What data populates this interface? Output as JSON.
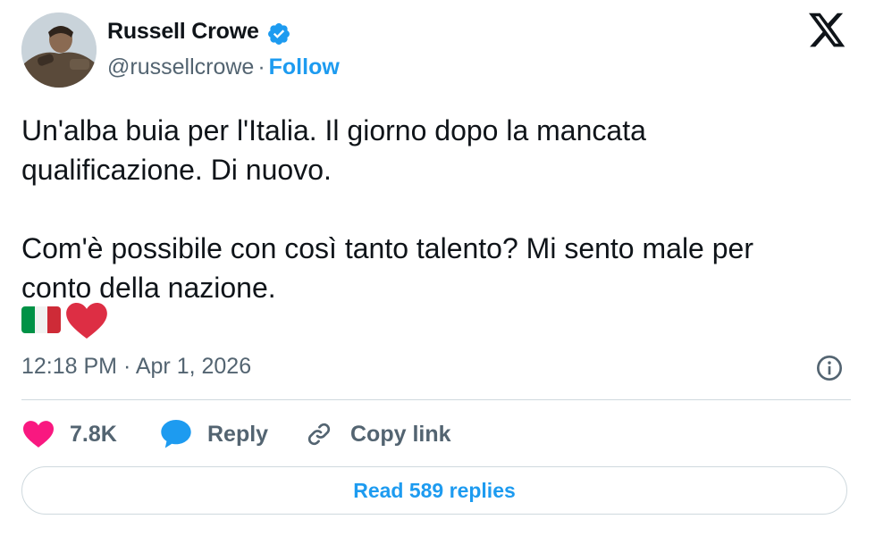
{
  "author": {
    "name": "Russell Crowe",
    "handle": "@russellcrowe",
    "separator": "·",
    "follow_label": "Follow"
  },
  "tweet": {
    "text": "Un'alba buia per l'Italia. Il giorno dopo la mancata\nqualificazione. Di nuovo.\n\nCom'è possibile con così tanto talento? Mi sento male per\nconto della nazione.",
    "emojis": [
      "italian-flag",
      "red-heart"
    ],
    "timestamp": "12:18 PM · Apr 1, 2026"
  },
  "actions": {
    "like_count": "7.8K",
    "reply_label": "Reply",
    "copy_link_label": "Copy link"
  },
  "footer": {
    "read_replies_label": "Read 589 replies"
  },
  "icons": {
    "verified": "verified-badge-icon",
    "platform": "x-logo-icon",
    "info": "info-icon",
    "like": "heart-icon",
    "reply": "reply-bubble-icon",
    "copy": "link-icon"
  },
  "colors": {
    "accent": "#1d9bf0",
    "like": "#f91880",
    "text": "#0f1419",
    "muted": "#536471",
    "border": "#cfd9de"
  }
}
